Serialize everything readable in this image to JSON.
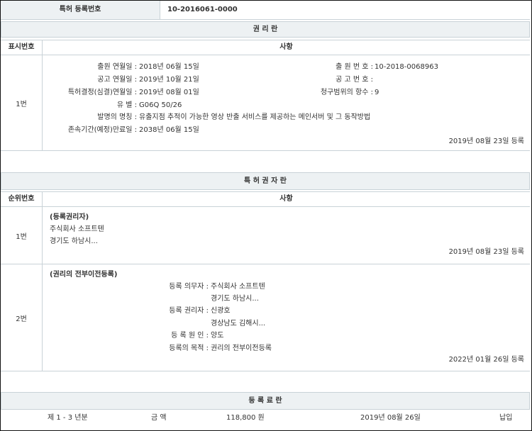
{
  "patent": {
    "reg_no_label": "특허 등록번호",
    "reg_no_value": "10-2016061-0000"
  },
  "rights_section": {
    "title": "권 리 란",
    "col_no": "표시번호",
    "col_content": "사항",
    "entry_no": "1번",
    "app_date_label": "출원 연월일 :",
    "app_date_value": "2018년 06월 15일",
    "app_no_label": "출 원 번 호 :",
    "app_no_value": "10-2018-0068963",
    "pub_date_label": "공고 연월일 :",
    "pub_date_value": "2019년 10월 21일",
    "pub_no_label": "공 고 번 호 :",
    "pub_no_value": "",
    "decision_date_label": "특허결정(심결)연월일 :",
    "decision_date_value": "2019년 08월 01일",
    "claims_label": "청구범위의 항수 :",
    "claims_value": "9",
    "class_label": "유 별 :",
    "class_value": "G06Q 50/26",
    "invention_label": "발명의 명칭 :",
    "invention_value": "유출지점 추적이 가능한 영상 반출 서비스를 제공하는 메인서버 및 그 동작방법",
    "expiry_label": "존속기간(예정)만료일 :",
    "expiry_value": "2038년 06월 15일",
    "reg_stamp": "2019년 08월 23일 등록"
  },
  "holders_section": {
    "title": "특 허 권 자 란",
    "col_no": "순위번호",
    "col_content": "사항",
    "entry1": {
      "no": "1번",
      "heading": "(등록권리자)",
      "line1": "주식회사 소프트텐",
      "line2": "경기도 하남시...",
      "stamp": "2019년 08월 23일 등록"
    },
    "entry2": {
      "no": "2번",
      "heading": "(권리의 전부이전등록)",
      "obligor_label": "등록 의무자 :",
      "obligor_name": "주식회사 소프트텐",
      "obligor_addr": "경기도 하남시...",
      "holder_label": "등록 권리자 :",
      "holder_name": "신광호",
      "holder_addr": "경상남도 김해시...",
      "cause_label": "등 록 원 인 :",
      "cause_value": "양도",
      "purpose_label": "등록의 목적 :",
      "purpose_value": "권리의 전부이전등록",
      "stamp": "2022년 01월 26일 등록"
    }
  },
  "fee_section": {
    "title": "등 록 료 란",
    "period": "제 1 - 3 년분",
    "amount_label": "금 액",
    "amount_value": "118,800 원",
    "paid_date": "2019년 08월 26일",
    "status": "납입"
  }
}
